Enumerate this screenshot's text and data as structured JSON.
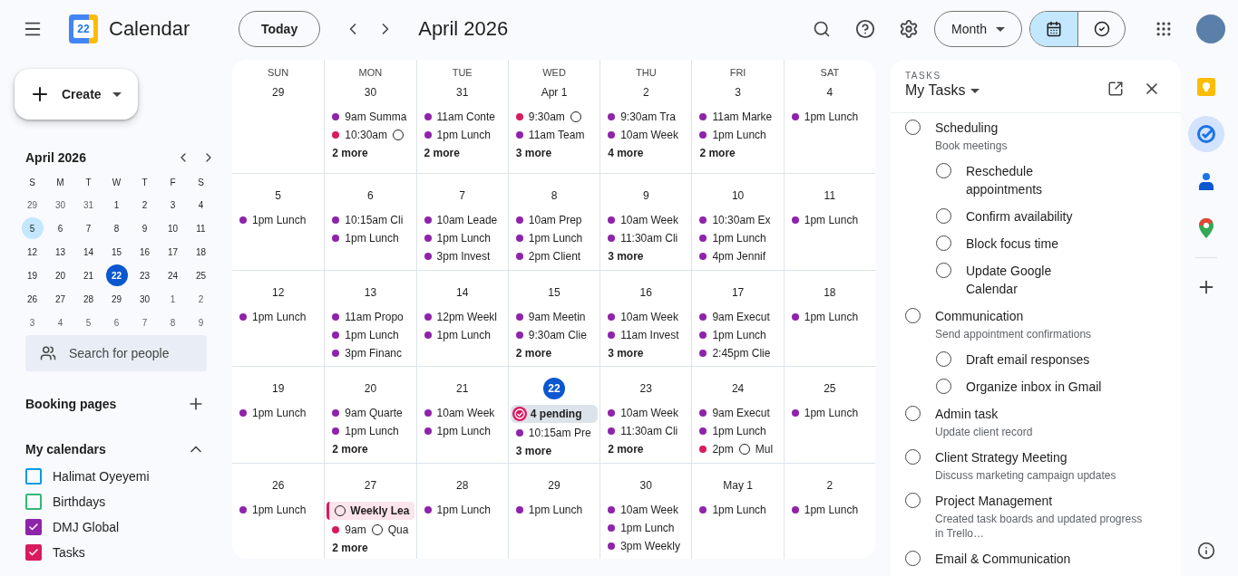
{
  "header": {
    "logo_day": "22",
    "app_name": "Calendar",
    "today_button": "Today",
    "period": "April 2026",
    "view_select": "Month",
    "view_toggle": [
      {
        "kind": "calendar",
        "selected": true
      },
      {
        "kind": "tasks",
        "selected": false
      }
    ]
  },
  "sidebar": {
    "create_button": "Create",
    "mini_calendar": {
      "title": "April 2026",
      "weekdays": [
        "S",
        "M",
        "T",
        "W",
        "T",
        "F",
        "S"
      ],
      "days": [
        {
          "day": "29",
          "kind": "outside"
        },
        {
          "day": "30",
          "kind": "outside"
        },
        {
          "day": "31",
          "kind": "outside"
        },
        {
          "day": "1",
          "kind": "normal"
        },
        {
          "day": "2",
          "kind": "normal"
        },
        {
          "day": "3",
          "kind": "normal"
        },
        {
          "day": "4",
          "kind": "normal"
        },
        {
          "day": "5",
          "kind": "selected"
        },
        {
          "day": "6",
          "kind": "normal"
        },
        {
          "day": "7",
          "kind": "normal"
        },
        {
          "day": "8",
          "kind": "normal"
        },
        {
          "day": "9",
          "kind": "normal"
        },
        {
          "day": "10",
          "kind": "normal"
        },
        {
          "day": "11",
          "kind": "normal"
        },
        {
          "day": "12",
          "kind": "normal"
        },
        {
          "day": "13",
          "kind": "normal"
        },
        {
          "day": "14",
          "kind": "normal"
        },
        {
          "day": "15",
          "kind": "normal"
        },
        {
          "day": "16",
          "kind": "normal"
        },
        {
          "day": "17",
          "kind": "normal"
        },
        {
          "day": "18",
          "kind": "normal"
        },
        {
          "day": "19",
          "kind": "normal"
        },
        {
          "day": "20",
          "kind": "normal"
        },
        {
          "day": "21",
          "kind": "normal"
        },
        {
          "day": "22",
          "kind": "today"
        },
        {
          "day": "23",
          "kind": "normal"
        },
        {
          "day": "24",
          "kind": "normal"
        },
        {
          "day": "25",
          "kind": "normal"
        },
        {
          "day": "26",
          "kind": "normal"
        },
        {
          "day": "27",
          "kind": "normal"
        },
        {
          "day": "28",
          "kind": "normal"
        },
        {
          "day": "29",
          "kind": "normal"
        },
        {
          "day": "30",
          "kind": "normal"
        },
        {
          "day": "1",
          "kind": "outside"
        },
        {
          "day": "2",
          "kind": "outside"
        },
        {
          "day": "3",
          "kind": "outside"
        },
        {
          "day": "4",
          "kind": "outside"
        },
        {
          "day": "5",
          "kind": "outside"
        },
        {
          "day": "6",
          "kind": "outside"
        },
        {
          "day": "7",
          "kind": "outside"
        },
        {
          "day": "8",
          "kind": "outside"
        },
        {
          "day": "9",
          "kind": "outside"
        }
      ]
    },
    "search": {
      "placeholder": "Search for people"
    },
    "booking_pages": "Booking pages",
    "my_calendars": {
      "title": "My calendars",
      "expanded": true,
      "items": [
        {
          "name": "Halimat Oyeyemi",
          "color": "#039be5",
          "checked": false
        },
        {
          "name": "Birthdays",
          "color": "#33b679",
          "checked": false
        },
        {
          "name": "DMJ Global",
          "color": "#8e24aa",
          "checked": true
        },
        {
          "name": "Tasks",
          "color": "#d81b60",
          "checked": true
        }
      ]
    }
  },
  "month": {
    "weekdays": [
      "SUN",
      "MON",
      "TUE",
      "WED",
      "THU",
      "FRI",
      "SAT"
    ],
    "cells": [
      {
        "date": "29",
        "today": false
      },
      {
        "date": "30",
        "today": false,
        "events": [
          {
            "kind": "event",
            "color": "#8e24aa",
            "text": "9am Summa"
          },
          {
            "kind": "task",
            "color": "#d81b60",
            "time": "10:30am"
          },
          {
            "kind": "more",
            "text": "2 more"
          }
        ]
      },
      {
        "date": "31",
        "today": false,
        "events": [
          {
            "kind": "event",
            "color": "#8e24aa",
            "text": "11am Conte"
          },
          {
            "kind": "event",
            "color": "#8e24aa",
            "text": "1pm Lunch"
          },
          {
            "kind": "more",
            "text": "2 more"
          }
        ]
      },
      {
        "date": "Apr 1",
        "today": false,
        "events": [
          {
            "kind": "task",
            "color": "#d81b60",
            "time": "9:30am"
          },
          {
            "kind": "event",
            "color": "#8e24aa",
            "text": "11am Team"
          },
          {
            "kind": "more",
            "text": "3 more"
          }
        ]
      },
      {
        "date": "2",
        "today": false,
        "events": [
          {
            "kind": "event",
            "color": "#8e24aa",
            "text": "9:30am Tra"
          },
          {
            "kind": "event",
            "color": "#8e24aa",
            "text": "10am Week"
          },
          {
            "kind": "more",
            "text": "4 more"
          }
        ]
      },
      {
        "date": "3",
        "today": false,
        "events": [
          {
            "kind": "event",
            "color": "#8e24aa",
            "text": "11am Marke"
          },
          {
            "kind": "event",
            "color": "#8e24aa",
            "text": "1pm Lunch"
          },
          {
            "kind": "more",
            "text": "2 more"
          }
        ]
      },
      {
        "date": "4",
        "today": false,
        "events": [
          {
            "kind": "event",
            "color": "#8e24aa",
            "text": "1pm Lunch"
          }
        ]
      },
      {
        "date": "5",
        "today": false,
        "events": [
          {
            "kind": "event",
            "color": "#8e24aa",
            "text": "1pm Lunch"
          }
        ]
      },
      {
        "date": "6",
        "today": false,
        "events": [
          {
            "kind": "event",
            "color": "#8e24aa",
            "text": "10:15am Cli"
          },
          {
            "kind": "event",
            "color": "#8e24aa",
            "text": "1pm Lunch"
          }
        ]
      },
      {
        "date": "7",
        "today": false,
        "events": [
          {
            "kind": "event",
            "color": "#8e24aa",
            "text": "10am Leade"
          },
          {
            "kind": "event",
            "color": "#8e24aa",
            "text": "1pm Lunch"
          },
          {
            "kind": "event",
            "color": "#8e24aa",
            "text": "3pm Invest"
          }
        ]
      },
      {
        "date": "8",
        "today": false,
        "events": [
          {
            "kind": "event",
            "color": "#8e24aa",
            "text": "10am Prep"
          },
          {
            "kind": "event",
            "color": "#8e24aa",
            "text": "1pm Lunch"
          },
          {
            "kind": "event",
            "color": "#8e24aa",
            "text": "2pm Client"
          }
        ]
      },
      {
        "date": "9",
        "today": false,
        "events": [
          {
            "kind": "event",
            "color": "#8e24aa",
            "text": "10am Week"
          },
          {
            "kind": "event",
            "color": "#8e24aa",
            "text": "11:30am Cli"
          },
          {
            "kind": "more",
            "text": "3 more"
          }
        ]
      },
      {
        "date": "10",
        "today": false,
        "events": [
          {
            "kind": "event",
            "color": "#8e24aa",
            "text": "10:30am Ex"
          },
          {
            "kind": "event",
            "color": "#8e24aa",
            "text": "1pm Lunch"
          },
          {
            "kind": "event",
            "color": "#8e24aa",
            "text": "4pm Jennif"
          }
        ]
      },
      {
        "date": "11",
        "today": false,
        "events": [
          {
            "kind": "event",
            "color": "#8e24aa",
            "text": "1pm Lunch"
          }
        ]
      },
      {
        "date": "12",
        "today": false,
        "events": [
          {
            "kind": "event",
            "color": "#8e24aa",
            "text": "1pm Lunch"
          }
        ]
      },
      {
        "date": "13",
        "today": false,
        "events": [
          {
            "kind": "event",
            "color": "#8e24aa",
            "text": "11am Propo"
          },
          {
            "kind": "event",
            "color": "#8e24aa",
            "text": "1pm Lunch"
          },
          {
            "kind": "event",
            "color": "#8e24aa",
            "text": "3pm Financ"
          }
        ]
      },
      {
        "date": "14",
        "today": false,
        "events": [
          {
            "kind": "event",
            "color": "#8e24aa",
            "text": "12pm Weekl"
          },
          {
            "kind": "event",
            "color": "#8e24aa",
            "text": "1pm Lunch"
          }
        ]
      },
      {
        "date": "15",
        "today": false,
        "events": [
          {
            "kind": "event",
            "color": "#8e24aa",
            "text": "9am Meetin"
          },
          {
            "kind": "event",
            "color": "#8e24aa",
            "text": "9:30am Clie"
          },
          {
            "kind": "more",
            "text": "2 more"
          }
        ]
      },
      {
        "date": "16",
        "today": false,
        "events": [
          {
            "kind": "event",
            "color": "#8e24aa",
            "text": "10am Week"
          },
          {
            "kind": "event",
            "color": "#8e24aa",
            "text": "11am Invest"
          },
          {
            "kind": "more",
            "text": "3 more"
          }
        ]
      },
      {
        "date": "17",
        "today": false,
        "events": [
          {
            "kind": "event",
            "color": "#8e24aa",
            "text": "9am Execut"
          },
          {
            "kind": "event",
            "color": "#8e24aa",
            "text": "1pm Lunch"
          },
          {
            "kind": "event",
            "color": "#8e24aa",
            "text": "2:45pm Clie"
          }
        ]
      },
      {
        "date": "18",
        "today": false,
        "events": [
          {
            "kind": "event",
            "color": "#8e24aa",
            "text": "1pm Lunch"
          }
        ]
      },
      {
        "date": "19",
        "today": false,
        "events": [
          {
            "kind": "event",
            "color": "#8e24aa",
            "text": "1pm Lunch"
          }
        ]
      },
      {
        "date": "20",
        "today": false,
        "events": [
          {
            "kind": "event",
            "color": "#8e24aa",
            "text": "9am Quarte"
          },
          {
            "kind": "event",
            "color": "#8e24aa",
            "text": "1pm Lunch"
          },
          {
            "kind": "more",
            "text": "2 more"
          }
        ]
      },
      {
        "date": "21",
        "today": false,
        "events": [
          {
            "kind": "event",
            "color": "#8e24aa",
            "text": "10am Week"
          },
          {
            "kind": "event",
            "color": "#8e24aa",
            "text": "1pm Lunch"
          }
        ]
      },
      {
        "date": "22",
        "today": true,
        "events": [
          {
            "kind": "pending",
            "color": "#d81b60",
            "text": "4 pending"
          },
          {
            "kind": "event",
            "color": "#8e24aa",
            "text": "10:15am Pre"
          },
          {
            "kind": "more",
            "text": "3 more"
          }
        ]
      },
      {
        "date": "23",
        "today": false,
        "events": [
          {
            "kind": "event",
            "color": "#8e24aa",
            "text": "10am Week"
          },
          {
            "kind": "event",
            "color": "#8e24aa",
            "text": "11:30am Cli"
          },
          {
            "kind": "more",
            "text": "2 more"
          }
        ]
      },
      {
        "date": "24",
        "today": false,
        "events": [
          {
            "kind": "event",
            "color": "#8e24aa",
            "text": "9am Execut"
          },
          {
            "kind": "event",
            "color": "#8e24aa",
            "text": "1pm Lunch"
          },
          {
            "kind": "task",
            "color": "#d81b60",
            "time": "2pm",
            "text": "Mul"
          }
        ]
      },
      {
        "date": "25",
        "today": false,
        "events": [
          {
            "kind": "event",
            "color": "#8e24aa",
            "text": "1pm Lunch"
          }
        ]
      },
      {
        "date": "26",
        "today": false,
        "events": [
          {
            "kind": "event",
            "color": "#8e24aa",
            "text": "1pm Lunch"
          }
        ]
      },
      {
        "date": "27",
        "today": false,
        "events": [
          {
            "kind": "allday",
            "color": "#d81b60",
            "text": "Weekly Lea"
          },
          {
            "kind": "task",
            "color": "#d81b60",
            "time": "9am",
            "text": "Qua"
          },
          {
            "kind": "more",
            "text": "2 more"
          }
        ]
      },
      {
        "date": "28",
        "today": false,
        "events": [
          {
            "kind": "event",
            "color": "#8e24aa",
            "text": "1pm Lunch"
          }
        ]
      },
      {
        "date": "29",
        "today": false,
        "events": [
          {
            "kind": "event",
            "color": "#8e24aa",
            "text": "1pm Lunch"
          }
        ]
      },
      {
        "date": "30",
        "today": false,
        "events": [
          {
            "kind": "event",
            "color": "#8e24aa",
            "text": "10am Week"
          },
          {
            "kind": "event",
            "color": "#8e24aa",
            "text": "1pm Lunch"
          },
          {
            "kind": "event",
            "color": "#8e24aa",
            "text": "3pm Weekly"
          }
        ]
      },
      {
        "date": "May 1",
        "today": false,
        "events": [
          {
            "kind": "event",
            "color": "#8e24aa",
            "text": "1pm Lunch"
          }
        ]
      },
      {
        "date": "2",
        "today": false,
        "events": [
          {
            "kind": "event",
            "color": "#8e24aa",
            "text": "1pm Lunch"
          }
        ]
      }
    ]
  },
  "tasks_panel": {
    "label": "TASKS",
    "list_name": "My Tasks",
    "tasks": [
      {
        "title": "Scheduling",
        "note": "Book meetings",
        "checked": false,
        "children": [
          {
            "title": "Reschedule appointments",
            "checked": false
          },
          {
            "title": "Confirm availability",
            "checked": false
          },
          {
            "title": "Block focus time",
            "checked": false
          },
          {
            "title": "Update Google Calendar",
            "checked": false
          }
        ]
      },
      {
        "title": "Communication",
        "note": "Send appointment confirmations",
        "checked": false,
        "children": [
          {
            "title": "Draft email responses",
            "checked": false
          },
          {
            "title": "Organize inbox in Gmail",
            "checked": false
          }
        ]
      },
      {
        "title": "Admin task",
        "note": "Update client record",
        "checked": false
      },
      {
        "title": "Client Strategy Meeting",
        "note": "Discuss marketing campaign updates",
        "checked": false
      },
      {
        "title": "Project Management",
        "note": "Created task boards and updated progress in Trello…",
        "checked": false
      },
      {
        "title": "Email & Communication",
        "checked": false
      }
    ]
  },
  "side_rail": [
    {
      "kind": "keep",
      "selected": false
    },
    {
      "kind": "tasks",
      "selected": true
    },
    {
      "kind": "contacts",
      "selected": false
    },
    {
      "kind": "maps",
      "selected": false
    }
  ]
}
